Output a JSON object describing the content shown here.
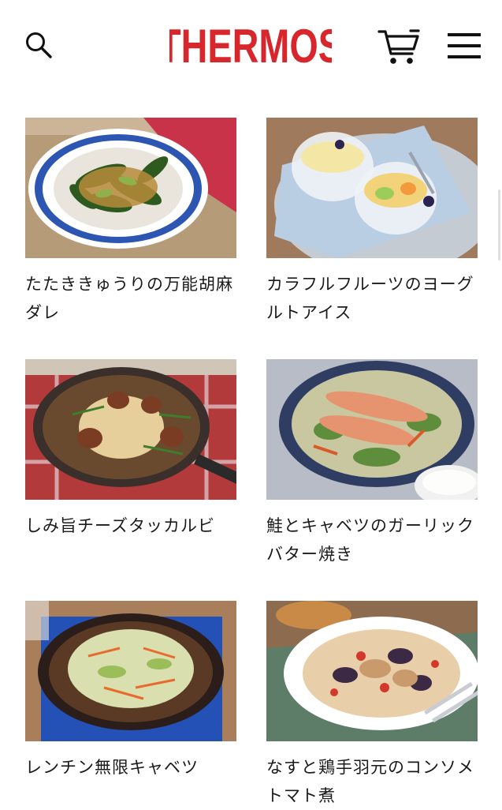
{
  "header": {
    "logo_text": "THERMOS",
    "brand_color": "#d7262c",
    "icons": {
      "search": "search-icon",
      "cart": "cart-icon",
      "menu": "hamburger-menu-icon"
    }
  },
  "recipes": [
    {
      "title": "たたききゅうりの万能胡麻ダレ"
    },
    {
      "title": "カラフルフルーツのヨーグルトアイス"
    },
    {
      "title": "しみ旨チーズタッカルビ"
    },
    {
      "title": "鮭とキャベツのガーリックバター焼き"
    },
    {
      "title": "レンチン無限キャベツ"
    },
    {
      "title": "なすと鶏手羽元のコンソメトマト煮"
    }
  ]
}
